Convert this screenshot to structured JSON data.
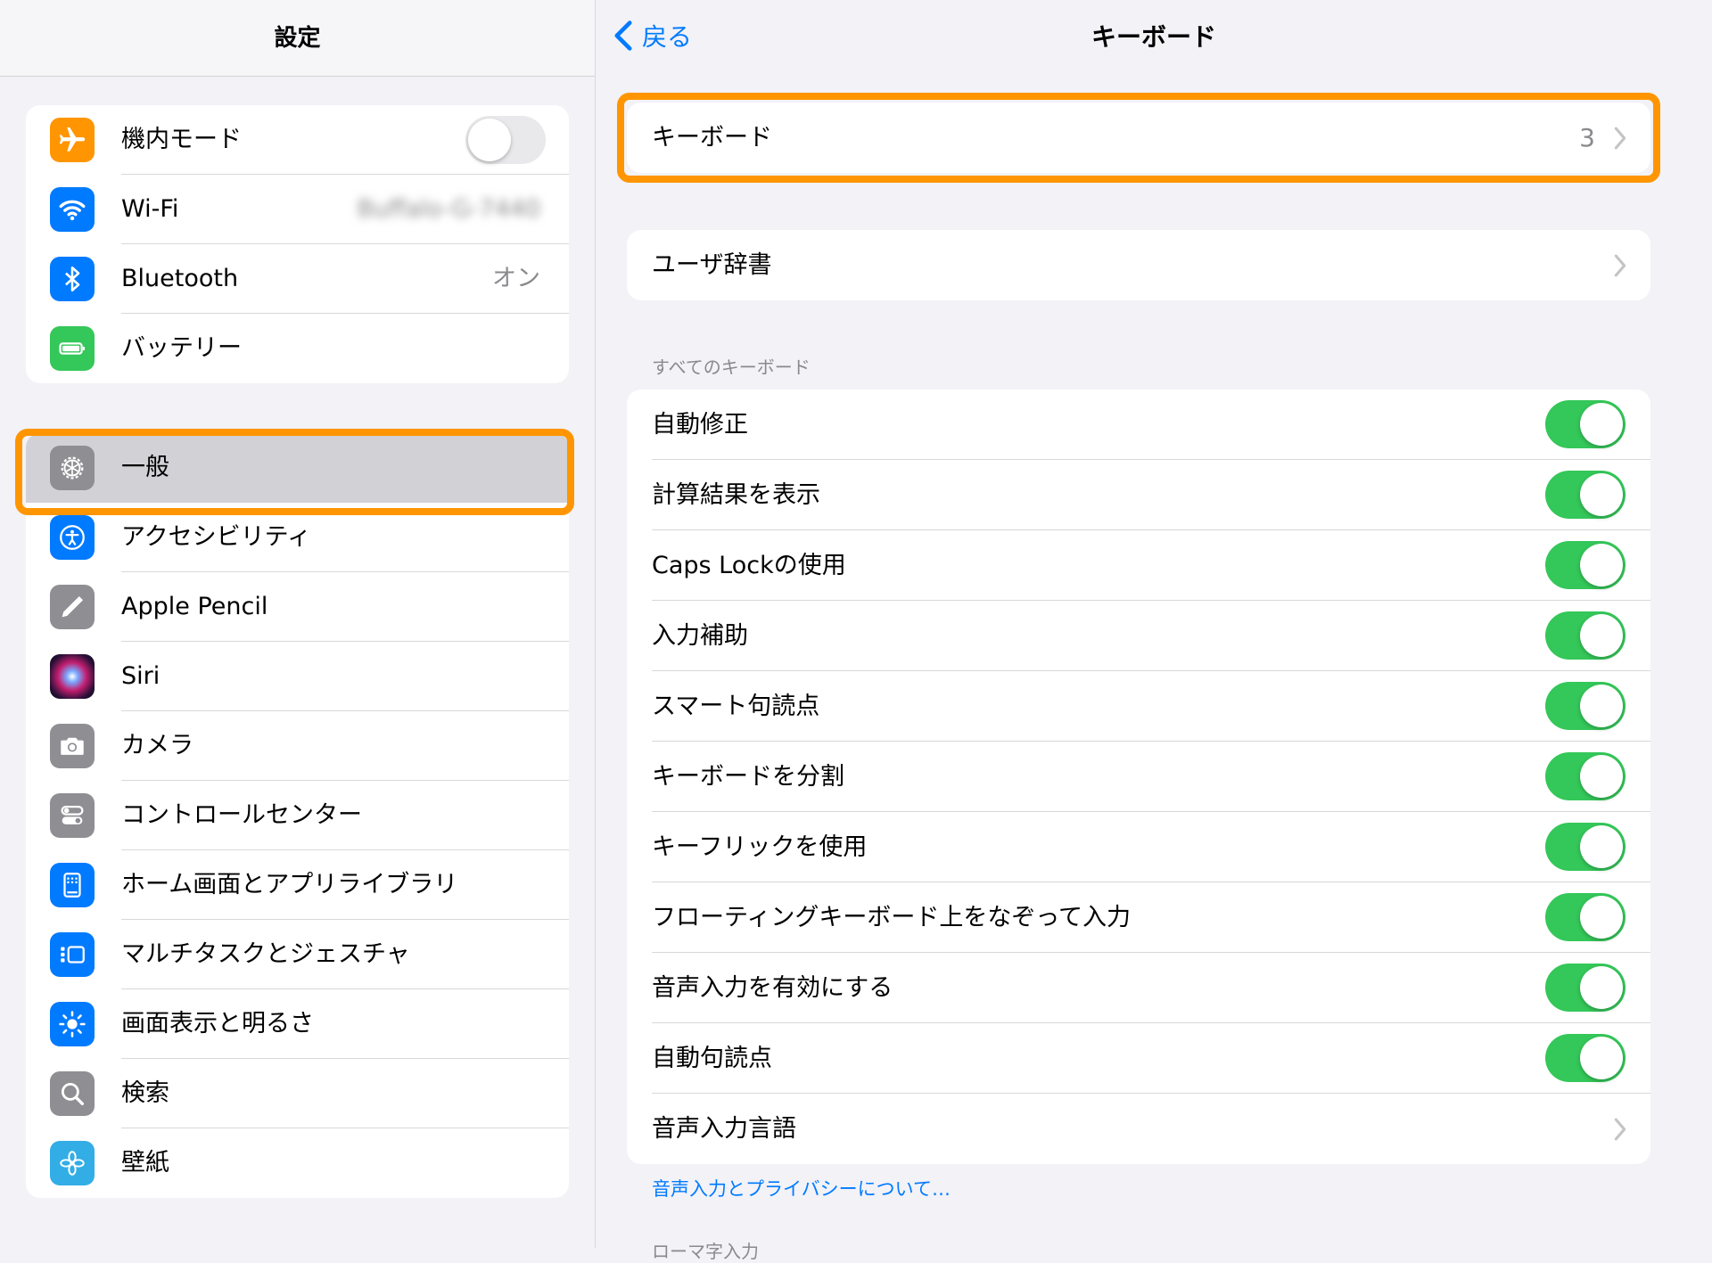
{
  "sidebar": {
    "title": "設定",
    "group1": [
      {
        "label": "機内モード",
        "icon": "airplane-icon",
        "color": "#ff9500",
        "toggle": "off"
      },
      {
        "label": "Wi-Fi",
        "icon": "wifi-icon",
        "color": "#007aff",
        "value": "Buffalo-G-7440"
      },
      {
        "label": "Bluetooth",
        "icon": "bluetooth-icon",
        "color": "#007aff",
        "value": "オン"
      },
      {
        "label": "バッテリー",
        "icon": "battery-icon",
        "color": "#34c759"
      }
    ],
    "group2": [
      {
        "label": "一般",
        "icon": "gear-icon",
        "color": "#8e8e93",
        "selected": true
      },
      {
        "label": "アクセシビリティ",
        "icon": "accessibility-icon",
        "color": "#007aff"
      },
      {
        "label": "Apple Pencil",
        "icon": "pencil-icon",
        "color": "#8e8e93"
      },
      {
        "label": "Siri",
        "icon": "siri-icon",
        "color": "#1c1c3c"
      },
      {
        "label": "カメラ",
        "icon": "camera-icon",
        "color": "#8e8e93"
      },
      {
        "label": "コントロールセンター",
        "icon": "control-center-icon",
        "color": "#8e8e93"
      },
      {
        "label": "ホーム画面とアプリライブラリ",
        "icon": "home-screen-icon",
        "color": "#007aff"
      },
      {
        "label": "マルチタスクとジェスチャ",
        "icon": "multitask-icon",
        "color": "#007aff"
      },
      {
        "label": "画面表示と明るさ",
        "icon": "brightness-icon",
        "color": "#007aff"
      },
      {
        "label": "検索",
        "icon": "search-icon",
        "color": "#8e8e93"
      },
      {
        "label": "壁紙",
        "icon": "wallpaper-icon",
        "color": "#32ade6"
      }
    ]
  },
  "nav": {
    "back_label": "戻る",
    "title": "キーボード"
  },
  "keyboards_row": {
    "label": "キーボード",
    "value": "3"
  },
  "user_dict_row": {
    "label": "ユーザ辞書"
  },
  "all_keyboards": {
    "header": "すべてのキーボード",
    "rows": [
      {
        "label": "自動修正",
        "toggle": "on"
      },
      {
        "label": "計算結果を表示",
        "toggle": "on"
      },
      {
        "label": "Caps Lockの使用",
        "toggle": "on"
      },
      {
        "label": "入力補助",
        "toggle": "on"
      },
      {
        "label": "スマート句読点",
        "toggle": "on"
      },
      {
        "label": "キーボードを分割",
        "toggle": "on"
      },
      {
        "label": "キーフリックを使用",
        "toggle": "on"
      },
      {
        "label": "フローティングキーボード上をなぞって入力",
        "toggle": "on"
      },
      {
        "label": "音声入力を有効にする",
        "toggle": "on"
      },
      {
        "label": "自動句読点",
        "toggle": "on"
      },
      {
        "label": "音声入力言語"
      }
    ],
    "footer_link": "音声入力とプライバシーについて…",
    "next_header": "ローマ字入力"
  },
  "colors": {
    "accent": "#007aff",
    "toggle_on": "#34c759",
    "highlight": "#ff9500"
  }
}
